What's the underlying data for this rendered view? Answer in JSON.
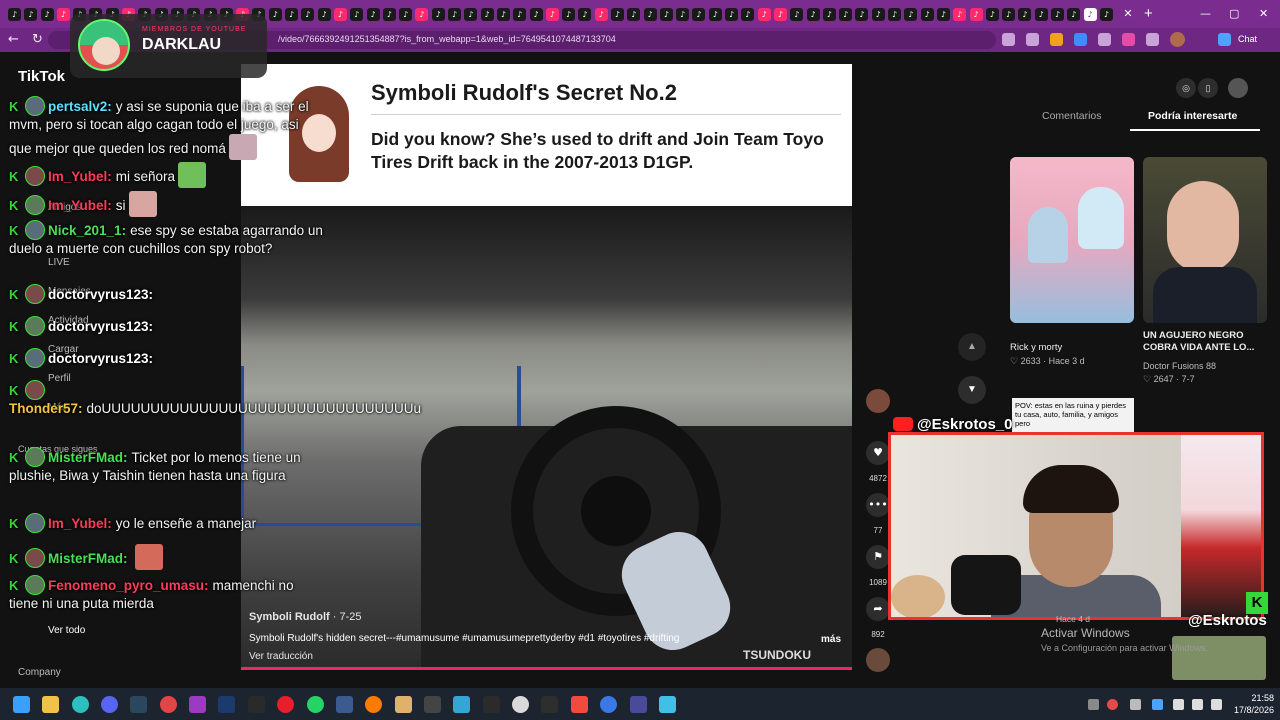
{
  "browser": {
    "url": "/video/7666392491251354887?is_from_webapp=1&web_id=7649541074487133704",
    "chat_button": "Chat"
  },
  "tiktok": {
    "logo": "TikTok",
    "nav": [
      "Amigos",
      "LIVE",
      "Mensajes",
      "Actividad",
      "Cargar",
      "Perfil",
      "Más"
    ],
    "following_header": "Cuentas que sigues",
    "see_all": "Ver todo",
    "company": "Company"
  },
  "streamer": {
    "subtitle": "MIEMBROS DE YOUTUBE",
    "name": "DARKLAU",
    "top_handle": "@Eskrotos_0",
    "bottom_handle": "@Eskrotos"
  },
  "chat": [
    {
      "user": "pertsalv2:",
      "text": "y asi se suponia que iba a ser el mvm, pero si tocan algo cagan todo el juego, asi que mejor que queden los red nomá",
      "color": "#5fe0ff"
    },
    {
      "user": "Im_Yubel:",
      "text": "mi señora",
      "color": "#ff3b5c"
    },
    {
      "user": "Im_Yubel:",
      "text": "si",
      "color": "#ff3b5c"
    },
    {
      "user": "Nick_201_1:",
      "text": "ese spy se estaba agarrando un duelo a muerte con cuchillos con spy robot?",
      "color": "#49e057"
    },
    {
      "user": "doctorvyrus123:",
      "text": "",
      "color": "#ffffff"
    },
    {
      "user": "doctorvyrus123:",
      "text": "",
      "color": "#ffffff"
    },
    {
      "user": "doctorvyrus123:",
      "text": "",
      "color": "#ffffff"
    },
    {
      "user": "Thonder57:",
      "text": "doUUUUUUUUUUUUUUUUUUUUUUUUUUUUUUUUu",
      "color": "#f5c242"
    },
    {
      "user": "MisterFMad:",
      "text": "Ticket por lo menos tiene un plushie, Biwa y Taishin tienen hasta una figura",
      "color": "#49e057"
    },
    {
      "user": "Im_Yubel:",
      "text": "yo le enseñe a manejar",
      "color": "#ff3b5c"
    },
    {
      "user": "MisterFMad:",
      "text": "",
      "color": "#49e057"
    },
    {
      "user": "Fenomeno_pyro_umasu:",
      "text": "mamenchi no tiene ni una puta mierda",
      "color": "#ff3b5c"
    }
  ],
  "video": {
    "banner_title": "Symboli Rudolf's Secret No.2",
    "banner_body": "Did you know? She’s used to drift and Join Team Toyo Tires Drift back in the 2007-2013 D1GP.",
    "author": "Symboli Rudolf",
    "date": "7-25",
    "caption": "Symboli Rudolf's hidden secret---#umamusume #umamusumeprettyderby #d1 #toyotires #drifting",
    "more": "más",
    "translate": "Ver traducción",
    "watermark": "TSUNDOKU"
  },
  "actions": {
    "likes": "4872",
    "comments": "77",
    "saves": "1089",
    "shares": "892"
  },
  "right_panel": {
    "tab_comments": "Comentarios",
    "tab_interest": "Podría interesarte",
    "items": [
      {
        "title": "Rick y morty",
        "meta": "♡ 2633 · Hace 3 d"
      },
      {
        "title": "UN AGUJERO NEGRO COBRA VIDA ANTE LO...",
        "author": "Doctor Fusions 88",
        "meta": "♡ 2647 · 7-7"
      }
    ],
    "pov_text": "POV: estas en las ruina y pierdes tu casa, auto, familia, y amigos pero",
    "webcam_meta": "Hace 4 d"
  },
  "windows_watermark": {
    "line1": "Activar Windows",
    "line2": "Ve a Configuración para activar Windows."
  },
  "taskbar": {
    "time": "21:58",
    "date": "17/8/2026"
  }
}
